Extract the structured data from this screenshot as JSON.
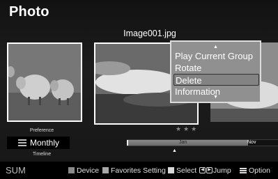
{
  "header": {
    "title": "Photo"
  },
  "current_file": "Image001.jpg",
  "popup_menu": {
    "items": [
      "Play Current Group",
      "Rotate",
      "Delete",
      "Information"
    ],
    "selected": "Delete",
    "scroll_up_icon": "triangle-up",
    "scroll_down_icon": "triangle-down"
  },
  "rating_stars": "★★★",
  "sort": {
    "preference_label": "Preference",
    "value": "Monthly",
    "timeline_label": "Timeline",
    "icon": "list-icon"
  },
  "timeline": {
    "start_month": "Jan",
    "end_month": "Nov",
    "fill_fraction": 0.8
  },
  "bottom_bar": {
    "source": "SUM",
    "device_label": "Device",
    "favorites_label": "Favorites Setting",
    "select_label": "Select",
    "jump_label": "Jump",
    "option_label": "Option"
  },
  "colors": {
    "menu_bg": "#909090",
    "menu_border": "#dcdcdc",
    "background": "#161616"
  }
}
